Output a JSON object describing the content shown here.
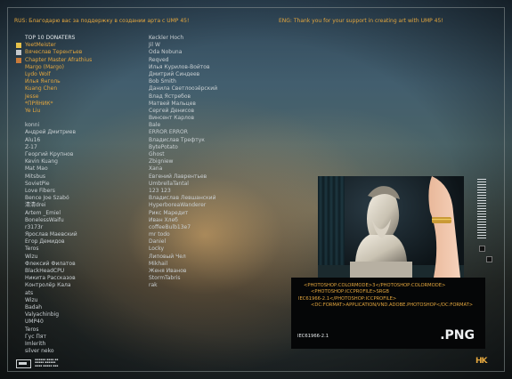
{
  "header": {
    "rus": "RUS: Благодарю вас за поддержку в создании арта с UMP 45!",
    "eng": "ENG: Thank you for your support in creating art with UMP 45!"
  },
  "colors": {
    "accent": "#e3a63e",
    "gold": "#e6c24a",
    "silver": "#c4c8cc",
    "bronze": "#c87a3a"
  },
  "top10": {
    "heading": "TOP 10 DONATERS",
    "names": [
      "YeetMeister",
      "Вячеслав Терентьев",
      "Chapter Master Afrathius",
      "Margo (Margo)",
      "Lydo Wolf",
      "Илья Янголь",
      "Kuang Chen",
      "Jesse",
      "*ПРЯНИК*",
      "Ye Liu"
    ]
  },
  "donors_col1": [
    "konni",
    "Андрей Дмитриев",
    "Alu16",
    "Z-17",
    "Георгий Крупнов",
    "Kevin Kuang",
    "Mat Mao",
    "Mitsbus",
    "SovietPie",
    "Love Fibers",
    "Bence Joe Szabó",
    "清清drei",
    "Artem _Emiel",
    "BonelessWaifu",
    "r3173r",
    "Ярослав Маевский",
    "Егор Демидов",
    "Teros",
    "Wizu",
    "Флексий Филатов",
    "BlackHeadCPU",
    "Никита Рассказов",
    "Контролёр Кала",
    "ats",
    "Wizu",
    "Badah",
    "Valyachinbig",
    "UMP40",
    "Teros",
    "Гус Пят",
    "Imlerith",
    "silver neko"
  ],
  "donors_col2": [
    "Keckler Hoch",
    "Jil W",
    "Oda Nobuna",
    "Reqved",
    "Илья Курилов-Войтов",
    "Дмитрий Синдеев",
    "Bob Smith",
    "Данила Светлоозёрский",
    "Влад Ястребов",
    "Матвей Мальцев",
    "Сергей Денисов",
    "Винсент Карлов",
    "Bale",
    "ERROR ERROR",
    "Владислав Трефтук",
    "BytePotato",
    "Ghost",
    "Zbigniew",
    "Xana",
    "Евгений Лаврентьев",
    "UmbrellaTantal",
    "123 123",
    "Владислав Левшанский",
    "HyperboreaWanderer",
    "Рикс Маредит",
    "Иван Хлеб",
    "coffeeBulb13e7",
    "mr todo",
    "Daniel",
    "Locky",
    "Липовый Чел",
    "Mikhail",
    "Женя Иванов",
    "StormTabris",
    "rak"
  ],
  "info_panel": {
    "lines": [
      "<PHOTOSHOP:COLORMODE>3</PHOTOSHOP:COLORMODE>",
      "<PHOTOSHOP:ICCPROFILE>SRGB",
      "IEC61966-2.1</PHOTOSHOP:ICCPROFILE>",
      "<DC:FORMAT>APPLICATION/VND.ADOBE.PHOTOSHOP</DC:FORMAT>"
    ],
    "spec": "IEC61966-2.1",
    "ext": ".PNG"
  },
  "logo": {
    "brand": "HK"
  }
}
